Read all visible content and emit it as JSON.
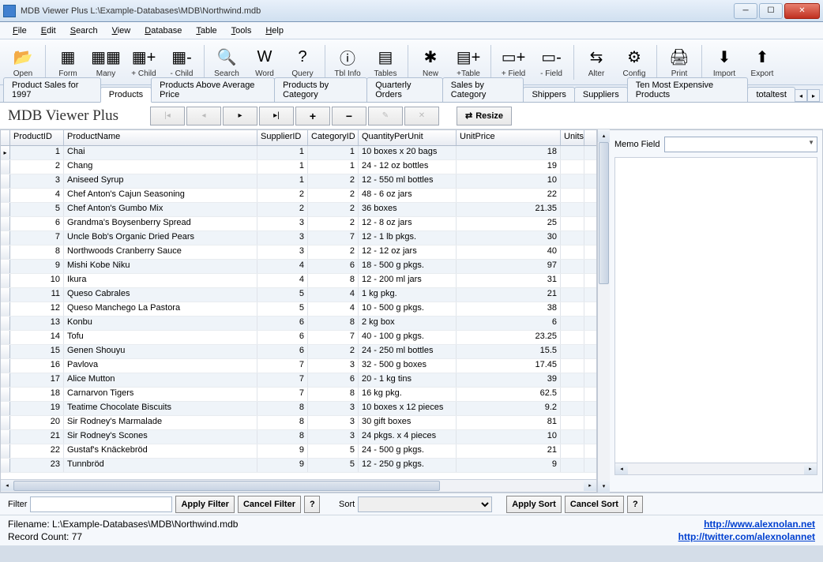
{
  "window": {
    "title": "MDB Viewer Plus L:\\Example-Databases\\MDB\\Northwind.mdb"
  },
  "menus": [
    "File",
    "Edit",
    "Search",
    "View",
    "Database",
    "Table",
    "Tools",
    "Help"
  ],
  "toolbar": [
    {
      "label": "Open"
    },
    {
      "label": "Form"
    },
    {
      "label": "Many"
    },
    {
      "label": "+ Child"
    },
    {
      "label": "- Child"
    },
    {
      "label": "Search"
    },
    {
      "label": "Word"
    },
    {
      "label": "Query"
    },
    {
      "label": "Tbl Info"
    },
    {
      "label": "Tables"
    },
    {
      "label": "New"
    },
    {
      "label": "+Table"
    },
    {
      "label": "+ Field"
    },
    {
      "label": "- Field"
    },
    {
      "label": "Alter"
    },
    {
      "label": "Config"
    },
    {
      "label": "Print"
    },
    {
      "label": "Import"
    },
    {
      "label": "Export"
    }
  ],
  "tabs": [
    "Product Sales for 1997",
    "Products",
    "Products Above Average Price",
    "Products by Category",
    "Quarterly Orders",
    "Sales by Category",
    "Shippers",
    "Suppliers",
    "Ten Most Expensive Products",
    "totaltest"
  ],
  "active_tab": 1,
  "page_title": "MDB Viewer Plus",
  "resize_label": "Resize",
  "columns": [
    "ProductID",
    "ProductName",
    "SupplierID",
    "CategoryID",
    "QuantityPerUnit",
    "UnitPrice",
    "UnitsI"
  ],
  "rows": [
    {
      "pid": 1,
      "name": "Chai",
      "sid": 1,
      "cid": 1,
      "qpu": "10 boxes x 20 bags",
      "up": "18"
    },
    {
      "pid": 2,
      "name": "Chang",
      "sid": 1,
      "cid": 1,
      "qpu": "24 - 12 oz bottles",
      "up": "19"
    },
    {
      "pid": 3,
      "name": "Aniseed Syrup",
      "sid": 1,
      "cid": 2,
      "qpu": "12 - 550 ml bottles",
      "up": "10"
    },
    {
      "pid": 4,
      "name": "Chef Anton's Cajun Seasoning",
      "sid": 2,
      "cid": 2,
      "qpu": "48 - 6 oz jars",
      "up": "22"
    },
    {
      "pid": 5,
      "name": "Chef Anton's Gumbo Mix",
      "sid": 2,
      "cid": 2,
      "qpu": "36 boxes",
      "up": "21.35"
    },
    {
      "pid": 6,
      "name": "Grandma's Boysenberry Spread",
      "sid": 3,
      "cid": 2,
      "qpu": "12 - 8 oz jars",
      "up": "25"
    },
    {
      "pid": 7,
      "name": "Uncle Bob's Organic Dried Pears",
      "sid": 3,
      "cid": 7,
      "qpu": "12 - 1 lb pkgs.",
      "up": "30"
    },
    {
      "pid": 8,
      "name": "Northwoods Cranberry Sauce",
      "sid": 3,
      "cid": 2,
      "qpu": "12 - 12 oz jars",
      "up": "40"
    },
    {
      "pid": 9,
      "name": "Mishi Kobe Niku",
      "sid": 4,
      "cid": 6,
      "qpu": "18 - 500 g pkgs.",
      "up": "97"
    },
    {
      "pid": 10,
      "name": "Ikura",
      "sid": 4,
      "cid": 8,
      "qpu": "12 - 200 ml jars",
      "up": "31"
    },
    {
      "pid": 11,
      "name": "Queso Cabrales",
      "sid": 5,
      "cid": 4,
      "qpu": "1 kg pkg.",
      "up": "21"
    },
    {
      "pid": 12,
      "name": "Queso Manchego La Pastora",
      "sid": 5,
      "cid": 4,
      "qpu": "10 - 500 g pkgs.",
      "up": "38"
    },
    {
      "pid": 13,
      "name": "Konbu",
      "sid": 6,
      "cid": 8,
      "qpu": "2 kg box",
      "up": "6"
    },
    {
      "pid": 14,
      "name": "Tofu",
      "sid": 6,
      "cid": 7,
      "qpu": "40 - 100 g pkgs.",
      "up": "23.25"
    },
    {
      "pid": 15,
      "name": "Genen Shouyu",
      "sid": 6,
      "cid": 2,
      "qpu": "24 - 250 ml bottles",
      "up": "15.5"
    },
    {
      "pid": 16,
      "name": "Pavlova",
      "sid": 7,
      "cid": 3,
      "qpu": "32 - 500 g boxes",
      "up": "17.45"
    },
    {
      "pid": 17,
      "name": "Alice Mutton",
      "sid": 7,
      "cid": 6,
      "qpu": "20 - 1 kg tins",
      "up": "39"
    },
    {
      "pid": 18,
      "name": "Carnarvon Tigers",
      "sid": 7,
      "cid": 8,
      "qpu": "16 kg pkg.",
      "up": "62.5"
    },
    {
      "pid": 19,
      "name": "Teatime Chocolate Biscuits",
      "sid": 8,
      "cid": 3,
      "qpu": "10 boxes x 12 pieces",
      "up": "9.2"
    },
    {
      "pid": 20,
      "name": "Sir Rodney's Marmalade",
      "sid": 8,
      "cid": 3,
      "qpu": "30 gift boxes",
      "up": "81"
    },
    {
      "pid": 21,
      "name": "Sir Rodney's Scones",
      "sid": 8,
      "cid": 3,
      "qpu": "24 pkgs. x 4 pieces",
      "up": "10"
    },
    {
      "pid": 22,
      "name": "Gustaf's Knäckebröd",
      "sid": 9,
      "cid": 5,
      "qpu": "24 - 500 g pkgs.",
      "up": "21"
    },
    {
      "pid": 23,
      "name": "Tunnbröd",
      "sid": 9,
      "cid": 5,
      "qpu": "12 - 250 g pkgs.",
      "up": "9"
    }
  ],
  "memo_label": "Memo Field",
  "filter": {
    "label": "Filter",
    "apply": "Apply Filter",
    "cancel": "Cancel Filter",
    "help": "?"
  },
  "sort": {
    "label": "Sort",
    "apply": "Apply Sort",
    "cancel": "Cancel Sort",
    "help": "?"
  },
  "status": {
    "filename": "Filename: L:\\Example-Databases\\MDB\\Northwind.mdb",
    "count": "Record Count:  77",
    "link1": "http://www.alexnolan.net",
    "link2": "http://twitter.com/alexnolannet"
  }
}
